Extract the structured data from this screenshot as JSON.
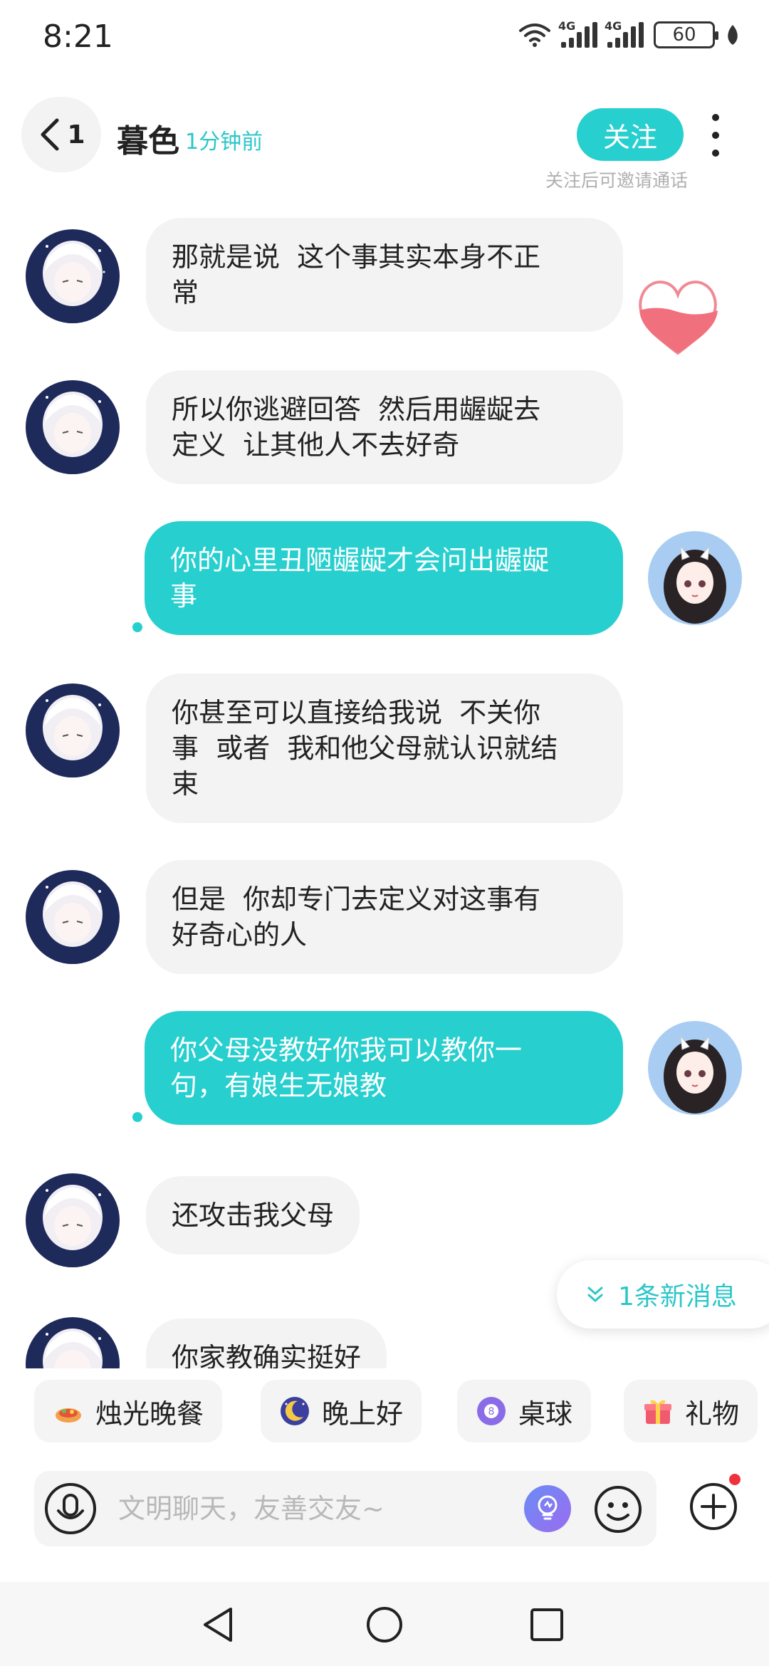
{
  "status_bar": {
    "time": "8:21",
    "network_1": "4G",
    "network_2": "4G",
    "battery": "60"
  },
  "header": {
    "back_count": "1",
    "contact_name": "暮色",
    "last_seen": "1分钟前",
    "follow_label": "关注",
    "follow_hint": "关注后可邀请通话"
  },
  "colors": {
    "accent": "#27cfcf",
    "incoming_bubble": "#f3f3f3",
    "unread_dot": "#f0323e"
  },
  "messages": [
    {
      "side": "in",
      "text": "那就是说  这个事其实本身不正\n常"
    },
    {
      "side": "in",
      "text": "所以你逃避回答  然后用龌龊去\n定义  让其他人不去好奇"
    },
    {
      "side": "out",
      "text": "你的心里丑陋龌龊才会问出龌龊\n事"
    },
    {
      "side": "in",
      "text": "你甚至可以直接给我说  不关你\n事  或者  我和他父母就认识就结\n束"
    },
    {
      "side": "in",
      "text": "但是  你却专门去定义对这事有\n好奇心的人"
    },
    {
      "side": "out",
      "text": "你父母没教好你我可以教你一\n句，有娘生无娘教"
    },
    {
      "side": "in",
      "text": "还攻击我父母"
    },
    {
      "side": "in",
      "text": "你家教确实挺好"
    }
  ],
  "new_message_pill": "1条新消息",
  "quick_chips": [
    {
      "label": "烛光晚餐",
      "icon": "candlelight-dinner-icon"
    },
    {
      "label": "晚上好",
      "icon": "moon-icon"
    },
    {
      "label": "桌球",
      "icon": "billiard-ball-icon"
    },
    {
      "label": "礼物",
      "icon": "gift-icon"
    }
  ],
  "input": {
    "placeholder": "文明聊天，友善交友~"
  }
}
